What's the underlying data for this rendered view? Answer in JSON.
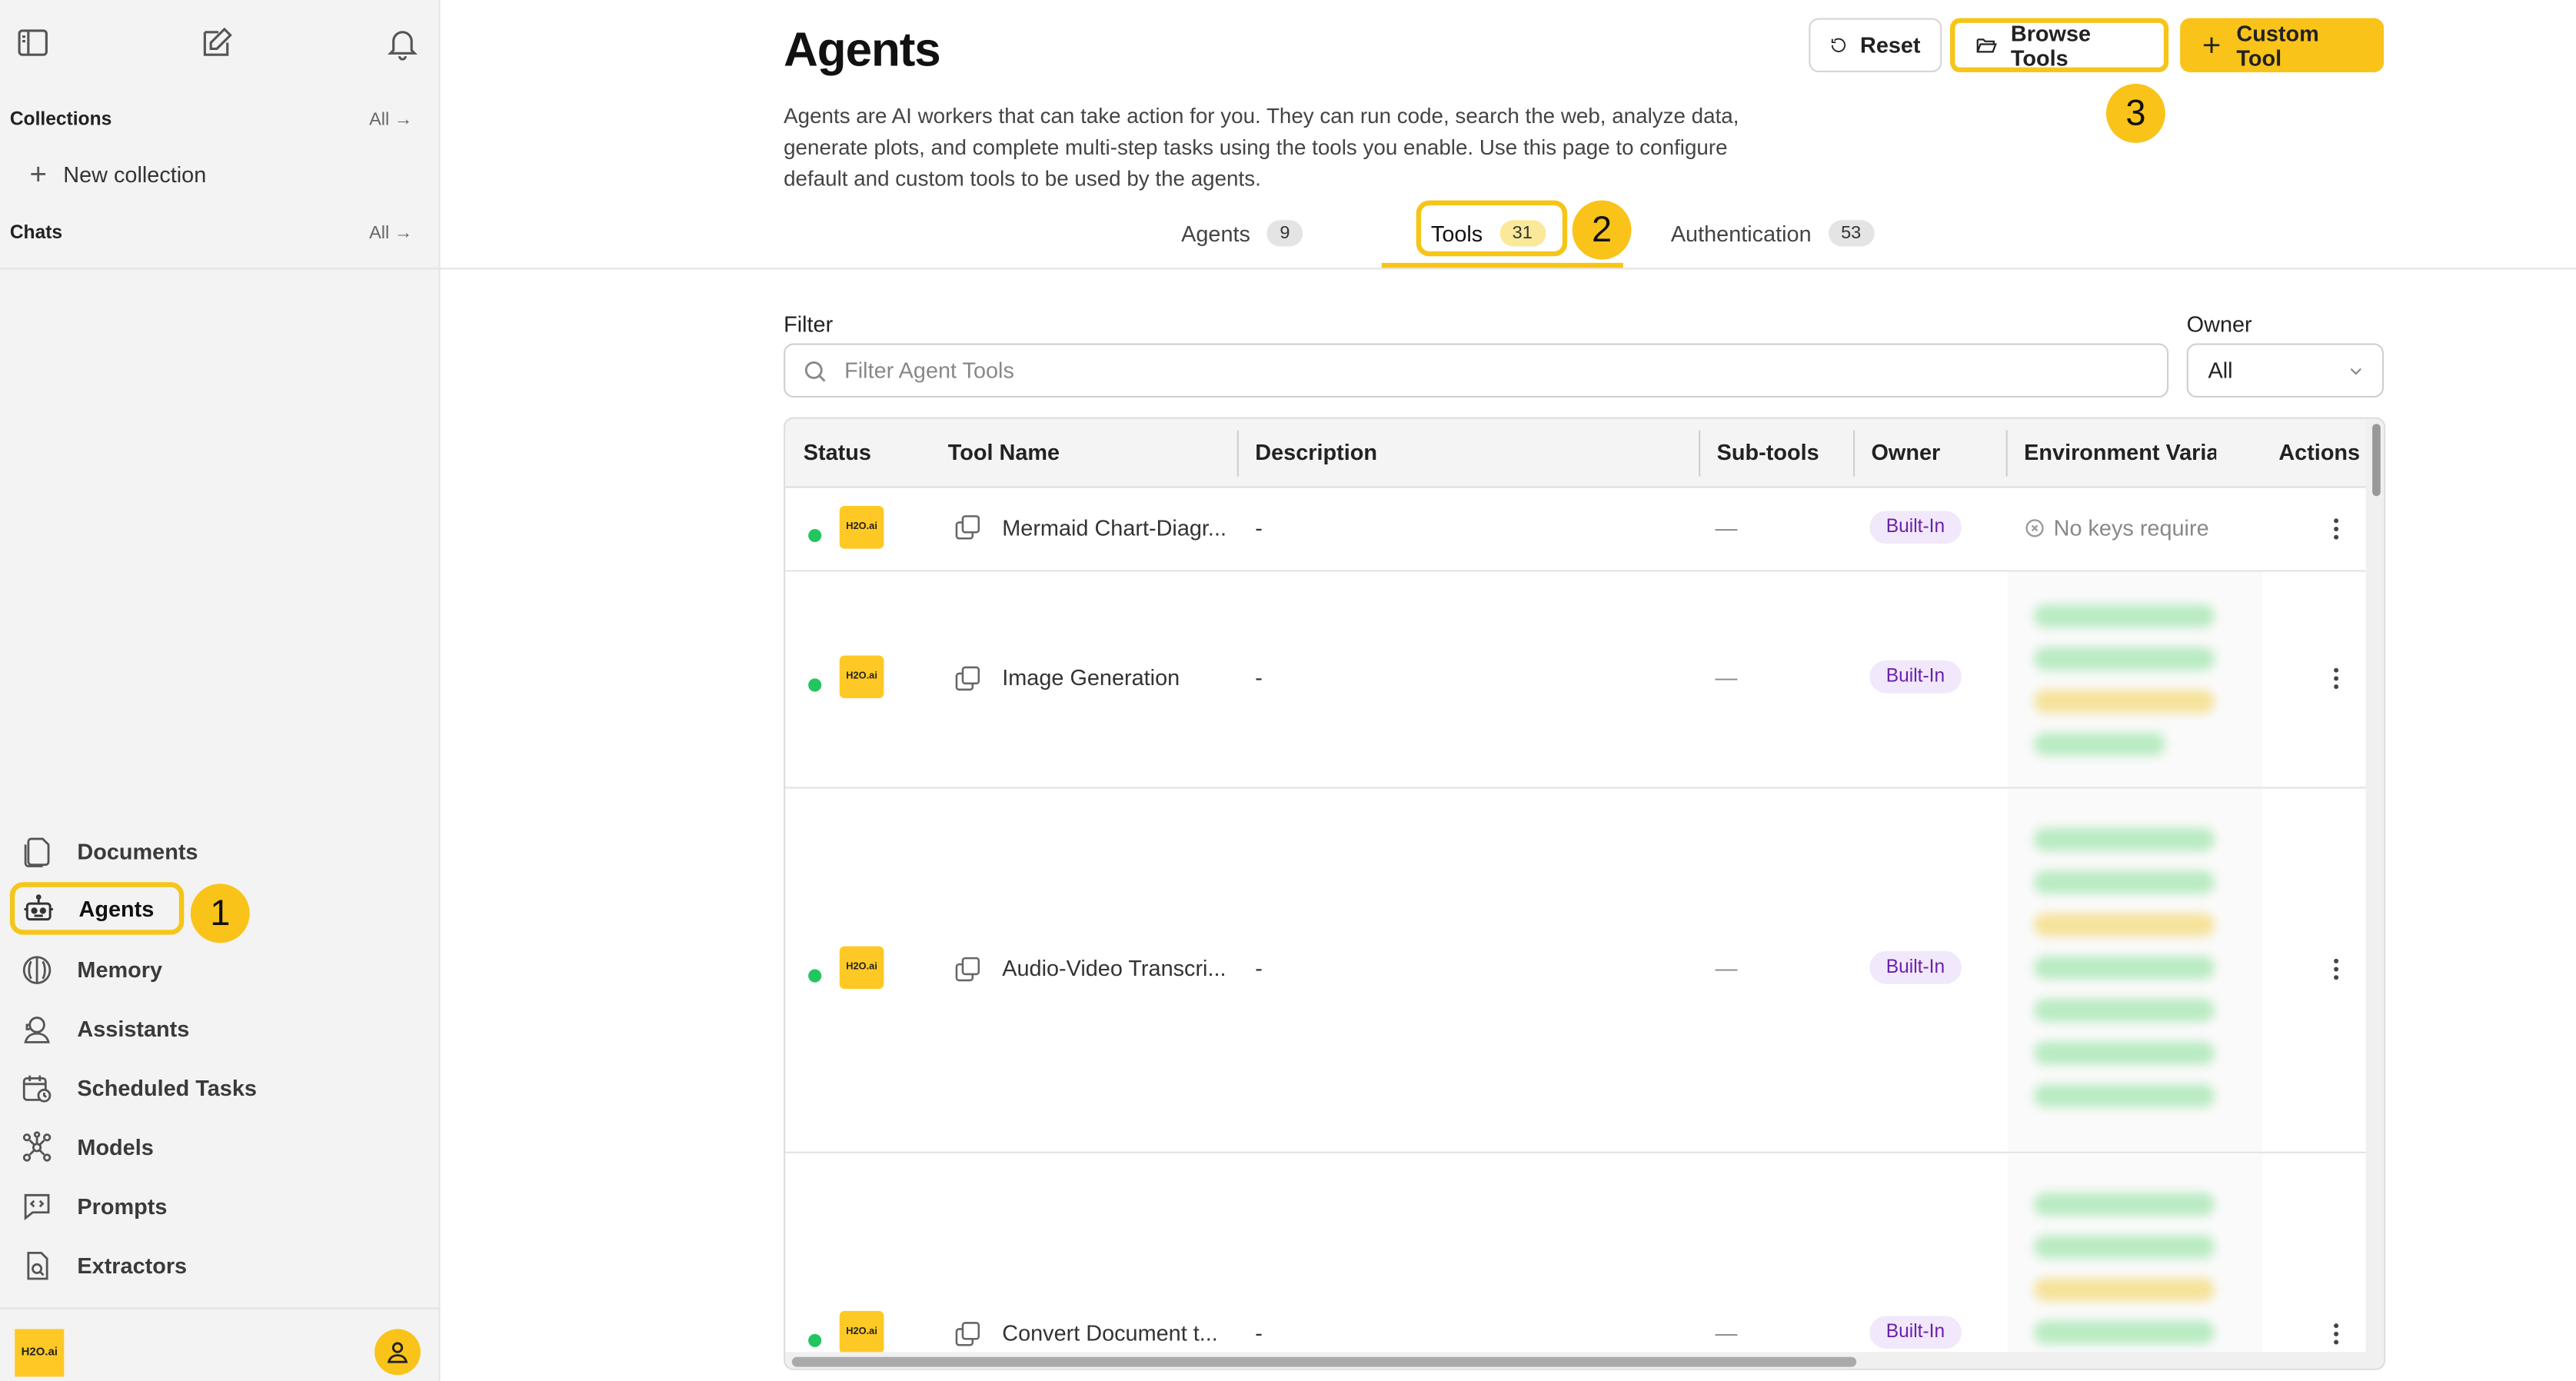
{
  "sidebar": {
    "collections_title": "Collections",
    "collections_all": "All →",
    "new_collection": "New collection",
    "chats_title": "Chats",
    "chats_all": "All →",
    "nav": [
      {
        "label": "Documents",
        "icon": "documents-icon"
      },
      {
        "label": "Agents",
        "icon": "robot-icon"
      },
      {
        "label": "Memory",
        "icon": "brain-icon"
      },
      {
        "label": "Assistants",
        "icon": "assistant-icon"
      },
      {
        "label": "Scheduled Tasks",
        "icon": "calendar-clock-icon"
      },
      {
        "label": "Models",
        "icon": "network-icon"
      },
      {
        "label": "Prompts",
        "icon": "code-chat-icon"
      },
      {
        "label": "Extractors",
        "icon": "doc-search-icon"
      }
    ],
    "logo_text": "H2O.ai"
  },
  "header": {
    "title": "Agents",
    "description": "Agents are AI workers that can take action for you. They can run code, search the web, analyze data, generate plots, and complete multi-step tasks using the tools you enable. Use this page to configure default and custom tools to be used by the agents.",
    "reset_label": "Reset",
    "browse_label": "Browse Tools",
    "custom_label": "Custom Tool"
  },
  "callouts": {
    "one": "1",
    "two": "2",
    "three": "3"
  },
  "tabs": [
    {
      "label": "Agents",
      "count": "9"
    },
    {
      "label": "Tools",
      "count": "31"
    },
    {
      "label": "Authentication",
      "count": "53"
    }
  ],
  "filter": {
    "label": "Filter",
    "placeholder": "Filter Agent Tools"
  },
  "owner": {
    "label": "Owner",
    "value": "All"
  },
  "table": {
    "columns": [
      "Status",
      "Tool Name",
      "Description",
      "Sub-tools",
      "Owner",
      "Environment Varia",
      "Actions"
    ],
    "rows": [
      {
        "name": "Mermaid Chart-Diagr...",
        "description": "-",
        "subtools": "—",
        "owner": "Built-In",
        "env": "No keys require",
        "logo": "H2O.ai"
      },
      {
        "name": "Image Generation",
        "description": "-",
        "subtools": "—",
        "owner": "Built-In",
        "logo": "H2O.ai"
      },
      {
        "name": "Audio-Video Transcri...",
        "description": "-",
        "subtools": "—",
        "owner": "Built-In",
        "logo": "H2O.ai"
      },
      {
        "name": "Convert Document t...",
        "description": "-",
        "subtools": "—",
        "owner": "Built-In",
        "logo": "H2O.ai"
      }
    ]
  },
  "colors": {
    "accent": "#f9c31a",
    "status_green": "#22c55e",
    "badge_bg": "#f2e8fb",
    "badge_text": "#6b21a8"
  }
}
